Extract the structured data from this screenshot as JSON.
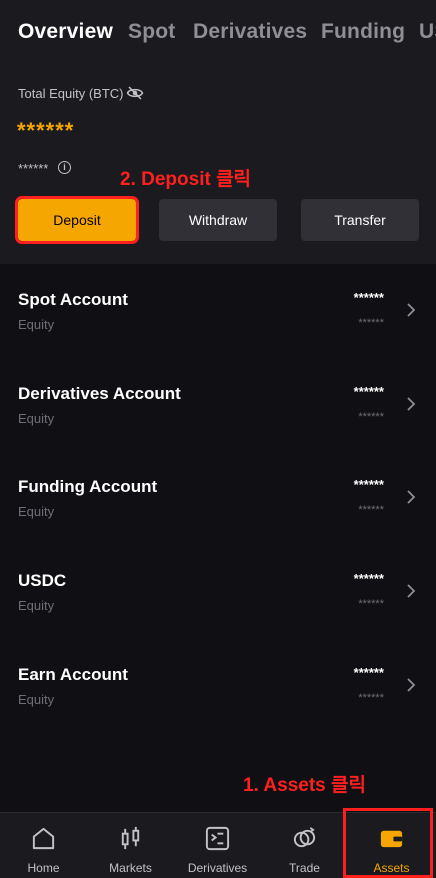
{
  "tabs": [
    "Overview",
    "Spot",
    "Derivatives",
    "Funding",
    "US"
  ],
  "equity": {
    "label": "Total Equity (BTC)",
    "value": "******",
    "sub_value": "******",
    "info_glyph": "i"
  },
  "annotations": {
    "deposit": "2. Deposit 클릭",
    "assets": "1. Assets 클릭"
  },
  "actions": {
    "deposit": "Deposit",
    "withdraw": "Withdraw",
    "transfer": "Transfer"
  },
  "accounts": [
    {
      "name": "Spot Account",
      "sub": "Equity",
      "value": "******",
      "value2": "******"
    },
    {
      "name": "Derivatives Account",
      "sub": "Equity",
      "value": "******",
      "value2": "******"
    },
    {
      "name": "Funding Account",
      "sub": "Equity",
      "value": "******",
      "value2": "******"
    },
    {
      "name": "USDC",
      "sub": "Equity",
      "value": "******",
      "value2": "******"
    },
    {
      "name": "Earn Account",
      "sub": "Equity",
      "value": "******",
      "value2": "******"
    }
  ],
  "nav": [
    {
      "label": "Home",
      "icon": "home-icon"
    },
    {
      "label": "Markets",
      "icon": "candlestick-icon"
    },
    {
      "label": "Derivatives",
      "icon": "derivatives-icon"
    },
    {
      "label": "Trade",
      "icon": "trade-icon"
    },
    {
      "label": "Assets",
      "icon": "wallet-icon"
    }
  ],
  "colors": {
    "accent": "#f6a600",
    "annotation": "#ff1f1f",
    "background": "#101014",
    "panel": "#1b1b1f"
  }
}
